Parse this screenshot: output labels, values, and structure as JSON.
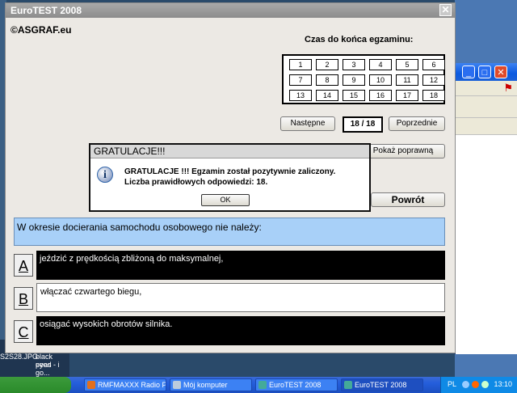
{
  "desktop": {
    "thumb_left": "S2S28.JPG",
    "thumb_right_line1": "black eyed",
    "thumb_right_line2": "peas - i go..."
  },
  "main_window": {
    "title": "EuroTEST 2008",
    "close_label": "✕",
    "copyright": "©ASGRAF.eu",
    "timer_label": "Czas do końca egzaminu:",
    "question_numbers": [
      "1",
      "2",
      "3",
      "4",
      "5",
      "6",
      "7",
      "8",
      "9",
      "10",
      "11",
      "12",
      "13",
      "14",
      "15",
      "16",
      "17",
      "18"
    ],
    "next_button": "Następne",
    "counter": "18 / 18",
    "prev_button": "Poprzednie",
    "show_correct_button": "Pokaż poprawną",
    "return_button": "Powrót",
    "question_text": "W okresie docierania samochodu osobowego nie należy:",
    "answers": [
      {
        "letter": "A",
        "text": "jeździć z prędkością zbliżoną do maksymalnej,"
      },
      {
        "letter": "B",
        "text": "włączać czwartego biegu,"
      },
      {
        "letter": "C",
        "text": "osiągać wysokich obrotów silnika."
      }
    ]
  },
  "dialog": {
    "title": "GRATULACJE!!!",
    "icon": "i",
    "line1": "GRATULACJE !!! Egzamin został pozytywnie zaliczony.",
    "line2": "Liczba prawidłowych odpowiedzi: 18.",
    "ok_button": "OK"
  },
  "bg_window": {
    "minimize": "_",
    "maximize": "□",
    "close": "✕"
  },
  "taskbar": {
    "items": [
      {
        "label": "RMFMAXXX Radio Pl..."
      },
      {
        "label": "Mój komputer"
      },
      {
        "label": "EuroTEST 2008"
      },
      {
        "label": "EuroTEST 2008"
      }
    ],
    "language": "PL",
    "time": "13:10"
  }
}
